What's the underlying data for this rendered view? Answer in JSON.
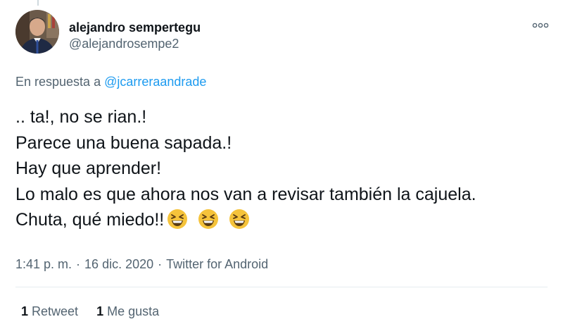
{
  "author": {
    "display_name": "alejandro sempertegu",
    "handle": "@alejandrosempe2"
  },
  "reply": {
    "prefix": "En respuesta a",
    "mention": "@jcarreraandrade"
  },
  "tweet": {
    "lines": [
      ".. ta!, no se rian.!",
      "Parece una buena sapada.!",
      "Hay que aprender!",
      "Lo malo es que ahora nos van a revisar también la cajuela.",
      "Chuta, qué miedo!!"
    ],
    "emoji": [
      "grinning-squinting-face",
      "grinning-squinting-face",
      "grinning-squinting-face"
    ]
  },
  "meta": {
    "time": "1:41 p. m.",
    "date": "16 dic. 2020",
    "source": "Twitter for Android",
    "separator": "·"
  },
  "stats": {
    "retweets_count": "1",
    "retweets_label": "Retweet",
    "likes_count": "1",
    "likes_label": "Me gusta"
  },
  "colors": {
    "link": "#1d9bf0",
    "secondary_text": "#536471",
    "primary_text": "#0f1419",
    "divider": "#e6ecf0"
  }
}
